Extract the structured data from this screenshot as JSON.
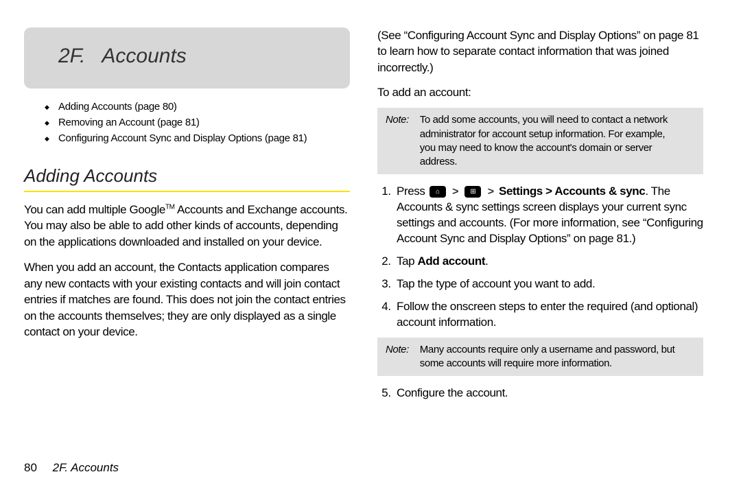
{
  "chapter": {
    "number": "2F.",
    "title": "Accounts"
  },
  "toc": [
    "Adding Accounts (page 80)",
    "Removing an Account (page 81)",
    "Configuring Account Sync and Display Options (page 81)"
  ],
  "section_heading": "Adding Accounts",
  "left_paragraphs": {
    "p1_pre": "You can add multiple Google",
    "p1_tm": "TM",
    "p1_post": " Accounts and Exchange accounts. You may also be able to add other kinds of accounts, depending on the applications downloaded and installed on your device.",
    "p2": "When you add an account, the Contacts application compares any new contacts with your existing contacts and will join contact entries if matches are found. This does not join the contact entries on the accounts themselves; they are only displayed as a single contact on your device."
  },
  "right": {
    "top_para": "(See “Configuring Account Sync and Display Options” on page 81 to learn how to separate contact information that was joined incorrectly.)",
    "subheading": "To add an account:",
    "note1": {
      "label": "Note:",
      "text": "To add some accounts, you will need to contact a network administrator for account setup information. For example, you may need to know the account's domain or server address."
    },
    "steps": {
      "s1_pre": "Press ",
      "s1_path": "Settings > Accounts & sync",
      "s1_post": ". The Accounts & sync settings screen displays your current sync settings and accounts. (For more information, see “Configuring Account Sync and Display Options” on page 81.)",
      "s2_pre": "Tap ",
      "s2_bold": "Add account",
      "s2_post": ".",
      "s3": "Tap the type of account you want to add.",
      "s4": "Follow the onscreen steps to enter the required (and optional) account information.",
      "s5": "Configure the account."
    },
    "note2": {
      "label": "Note:",
      "text": "Many accounts require only a username and password, but some accounts will require more information."
    }
  },
  "footer": {
    "page_number": "80",
    "chapter_ref": "2F. Accounts"
  },
  "glyphs": {
    "home": "⌂",
    "grid": "⊞",
    "gt": ">"
  }
}
